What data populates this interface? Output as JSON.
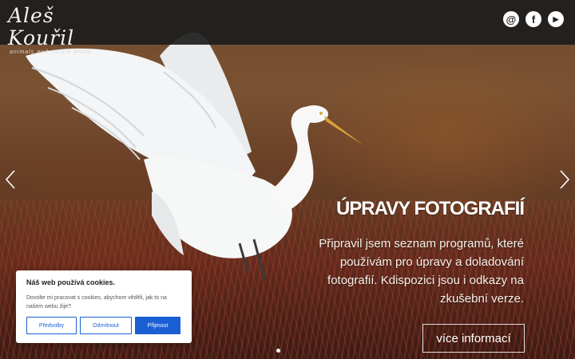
{
  "header": {
    "logo_name": "Aleš Kouřil",
    "logo_tagline": "animals and nature photo",
    "social": [
      {
        "icon": "email-icon",
        "glyph": "@"
      },
      {
        "icon": "facebook-icon",
        "glyph": "f"
      },
      {
        "icon": "youtube-icon",
        "glyph": "▶"
      }
    ]
  },
  "slider": {
    "title": "ÚPRAVY FOTOGRAFIÍ",
    "text": "Připravil jsem seznam programů, které používám pro úpravy a doladování fotografií. Kdispozici jsou i odkazy na zkušební verze.",
    "button_label": "více informací",
    "prev_icon": "chevron-left-icon",
    "next_icon": "chevron-right-icon"
  },
  "cookie": {
    "title": "Náš web používá cookies.",
    "text": "Dovolte mi pracovat s cookies, abychom věděli, jak to na našem webu žije?",
    "preferences_label": "Předvolby",
    "reject_label": "Odmítnout",
    "accept_label": "Přijmout"
  },
  "colors": {
    "header_bg": "#1c1c1c",
    "cookie_accent": "#1a5fd4"
  }
}
